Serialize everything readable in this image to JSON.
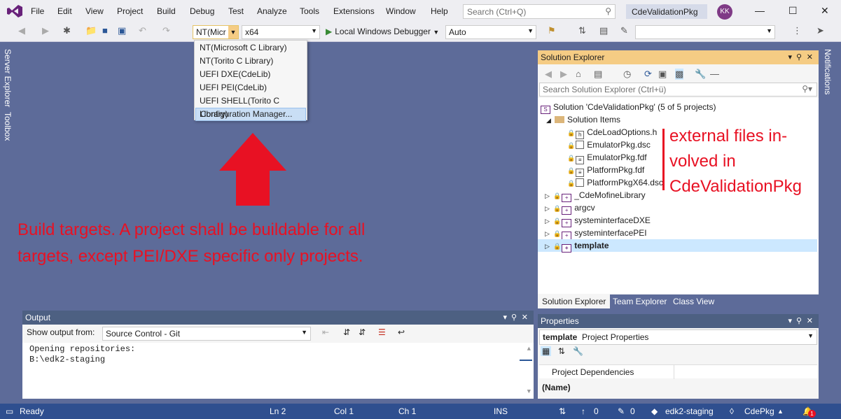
{
  "menubar": {
    "items": [
      "File",
      "Edit",
      "View",
      "Project",
      "Build",
      "Debug",
      "Test",
      "Analyze",
      "Tools",
      "Extensions",
      "Window",
      "Help"
    ],
    "search_placeholder": "Search (Ctrl+Q)",
    "solution_title": "CdeValidationPkg",
    "avatar_initials": "KK"
  },
  "toolbar": {
    "config_value": "NT(Micr",
    "platform_value": "x64",
    "debugger_label": "Local Windows Debugger",
    "auto_value": "Auto"
  },
  "config_dropdown": {
    "items": [
      "NT(Microsoft C Library)",
      "NT(Torito C Library)",
      "UEFI DXE(CdeLib)",
      "UEFI PEI(CdeLib)",
      "UEFI SHELL(Torito C Library)",
      "Configuration Manager..."
    ]
  },
  "side_tabs": {
    "server_explorer": "Server Explorer",
    "toolbox": "Toolbox",
    "notifications": "Notifications"
  },
  "annotations": {
    "build_line1": "Build targets. A project shall be buildable for all",
    "build_line2": "targets, except PEI/DXE specific only projects.",
    "ext_line1": "external files in-",
    "ext_line2": "volved in",
    "ext_line3": "CdeValidationPkg"
  },
  "solution_explorer": {
    "title": "Solution Explorer",
    "search_placeholder": "Search Solution Explorer (Ctrl+ü)",
    "solution_label": "Solution 'CdeValidationPkg' (5 of 5 projects)",
    "solution_items_label": "Solution Items",
    "files": [
      "CdeLoadOptions.h",
      "EmulatorPkg.dsc",
      "EmulatorPkg.fdf",
      "PlatformPkg.fdf",
      "PlatformPkgX64.dsc"
    ],
    "projects": [
      "_CdeMofineLibrary",
      "argcv",
      "systeminterfaceDXE",
      "systeminterfacePEI",
      "template"
    ],
    "tabs": [
      "Solution Explorer",
      "Team Explorer",
      "Class View"
    ]
  },
  "properties": {
    "title": "Properties",
    "object_name": "template",
    "object_type": "Project Properties",
    "row_label": "Project Dependencies",
    "description": "(Name)"
  },
  "output": {
    "title": "Output",
    "show_from_label": "Show output from:",
    "source_value": "Source Control - Git",
    "lines": [
      "Opening repositories:",
      "B:\\edk2-staging"
    ]
  },
  "statusbar": {
    "ready": "Ready",
    "ln": "Ln 2",
    "col": "Col 1",
    "ch": "Ch 1",
    "ins": "INS",
    "push_count": "0",
    "changes_count": "0",
    "branch": "edk2-staging",
    "repo": "CdePkg",
    "notif_count": "1"
  },
  "colors": {
    "accent": "#2f4f8f",
    "annotation": "#e81123",
    "panel_title_active": "#f5cc84"
  }
}
